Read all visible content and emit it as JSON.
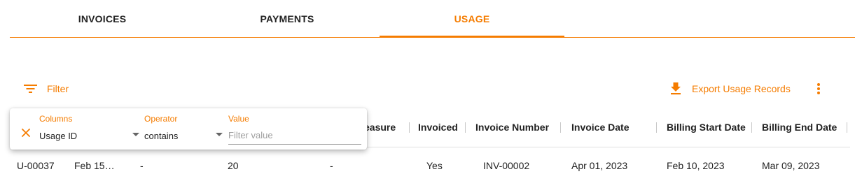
{
  "tabs": [
    {
      "label": "INVOICES",
      "active": false
    },
    {
      "label": "PAYMENTS",
      "active": false
    },
    {
      "label": "USAGE",
      "active": true
    }
  ],
  "toolbar": {
    "filter_label": "Filter",
    "export_label": "Export Usage Records",
    "filter_icon": "filter-list-icon",
    "export_icon": "download-icon",
    "more_icon": "more-vertical-icon"
  },
  "table": {
    "columns": [
      "easure",
      "Invoiced",
      "Invoice Number",
      "Invoice Date",
      "Billing Start Date",
      "Billing End Date"
    ],
    "rows": [
      [
        "U-00037",
        "Feb 15…",
        "-",
        "20",
        "-",
        "Yes",
        "INV-00002",
        "Apr 01, 2023",
        "Feb 10, 2023",
        "Mar 09, 2023"
      ]
    ]
  },
  "filter_panel": {
    "columns_label": "Columns",
    "columns_value": "Usage ID",
    "operator_label": "Operator",
    "operator_value": "contains",
    "value_label": "Value",
    "value_placeholder": "Filter value",
    "value": ""
  },
  "colors": {
    "accent": "#f57c00",
    "text": "#222222",
    "divider": "#e0e0e0"
  }
}
